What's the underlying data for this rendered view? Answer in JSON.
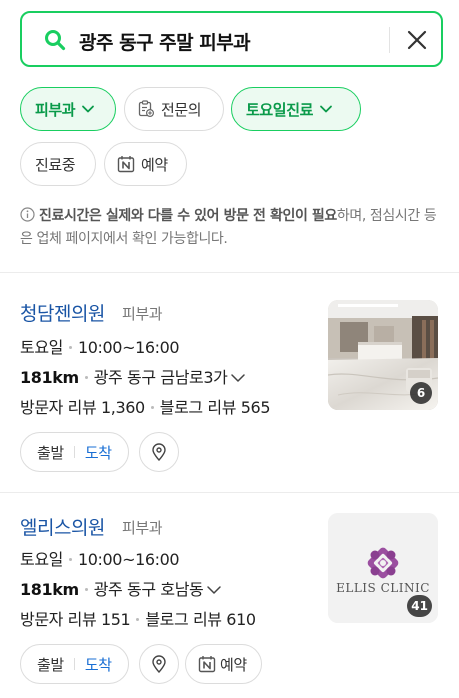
{
  "search": {
    "query": "광주 동구 주말 피부과"
  },
  "filters": {
    "dermatology": "피부과",
    "specialist": "전문의",
    "saturday": "토요일진료",
    "open_now": "진료중",
    "reservation": "예약"
  },
  "notice": {
    "bold": "진료시간은 실제와 다를 수 있어 방문 전 확인이 필요",
    "rest": "하며, 점심시간 등은 업체 페이지에서 확인 가능합니다."
  },
  "results": [
    {
      "name": "청담젠의원",
      "category": "피부과",
      "day": "토요일",
      "hours": "10:00~16:00",
      "distance": "181km",
      "address": "광주 동구 금남로3가",
      "visitor_review": "방문자 리뷰 1,360",
      "blog_review": "블로그 리뷰 565",
      "photo_count": "6",
      "depart": "출발",
      "arrive": "도착"
    },
    {
      "name": "엘리스의원",
      "category": "피부과",
      "day": "토요일",
      "hours": "10:00~16:00",
      "distance": "181km",
      "address": "광주 동구 호남동",
      "visitor_review": "방문자 리뷰 151",
      "blog_review": "블로그 리뷰 610",
      "photo_count": "41",
      "logo_text": "ELLIS CLINIC",
      "depart": "출발",
      "arrive": "도착",
      "reserve": "예약"
    }
  ],
  "colors": {
    "accent": "#19ce60",
    "link": "#1a55a5"
  },
  "icons": [
    "search-icon",
    "close-icon",
    "chevron-down-icon",
    "clipboard-icon",
    "calendar-n-icon",
    "info-icon",
    "map-pin-icon"
  ]
}
